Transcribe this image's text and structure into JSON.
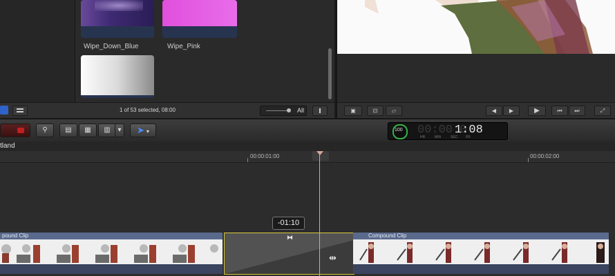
{
  "browser": {
    "thumbnails": [
      {
        "label": "Wipe_Down_Blue"
      },
      {
        "label": "Wipe_Pink"
      },
      {
        "label": ""
      }
    ],
    "status": "1 of 53 selected, 08:00",
    "zoom_option": "All"
  },
  "toolbar": {
    "timecode": {
      "progress": "100",
      "display": "1:08",
      "ghost_digits": "00:00:0",
      "units": [
        "HR",
        "MIN",
        "SEC",
        "FR"
      ]
    }
  },
  "timeline": {
    "project_name": "tland",
    "ruler": [
      "00:00:01:00",
      "00:00:02:00"
    ],
    "clips": [
      {
        "title": "pound Clip"
      },
      {
        "title": "Compound Clip"
      }
    ],
    "trim_tooltip": "-01:10"
  },
  "colors": {
    "accent_blue": "#2f63c9",
    "clip_header": "#5a6a8d",
    "transition_border": "#d8c93a",
    "playhead": "#d7a79a"
  }
}
